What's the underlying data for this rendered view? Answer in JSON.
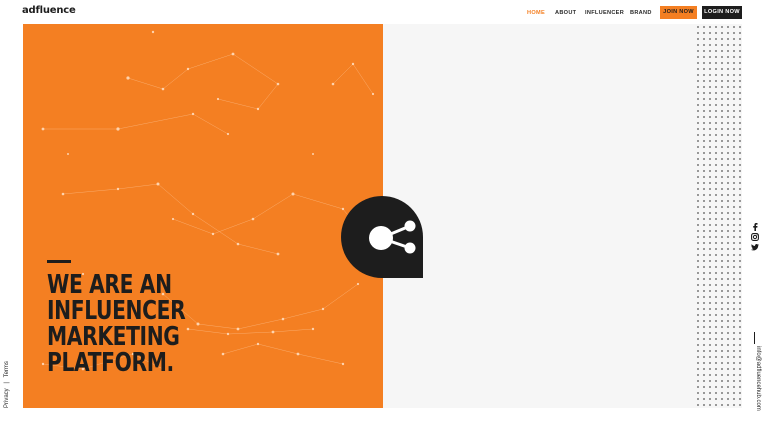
{
  "header": {
    "logo": "adfluence",
    "nav": [
      {
        "label": "HOME",
        "active": true
      },
      {
        "label": "ABOUT",
        "active": false
      },
      {
        "label": "INFLUENCER",
        "active": false
      },
      {
        "label": "BRAND",
        "active": false
      }
    ],
    "join_label": "JOIN NOW",
    "login_label": "LOGIN NOW"
  },
  "hero": {
    "headline": [
      "WE ARE AN",
      "INFLUENCER",
      "MARKETING",
      "PLATFORM."
    ],
    "brand_icon": "share-node-icon"
  },
  "footer": {
    "privacy": "Privacy",
    "separator": "|",
    "terms": "Terms",
    "email": "info@adfluencehub.com"
  },
  "social": [
    "facebook-icon",
    "instagram-icon",
    "twitter-icon"
  ],
  "colors": {
    "accent": "#f47f22",
    "dark": "#1d1d1d",
    "panel": "#f6f6f6"
  }
}
